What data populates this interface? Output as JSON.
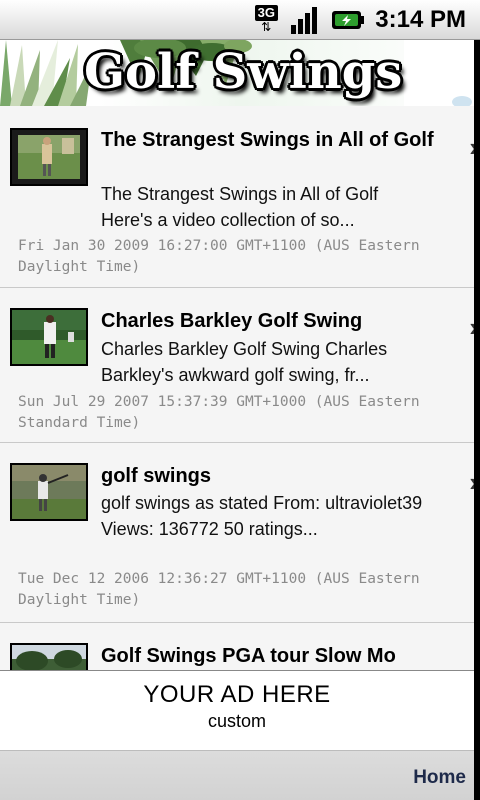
{
  "status_bar": {
    "network": "3G",
    "time": "3:14 PM"
  },
  "header": {
    "title": "Golf Swings"
  },
  "videos": [
    {
      "title": "The Strangest Swings in All of Golf",
      "description": "The Strangest Swings in All of Golf Here's a video collection of so...",
      "date": "Fri Jan 30 2009 16:27:00 GMT+1100 (AUS Eastern Daylight Time)"
    },
    {
      "title": "Charles Barkley Golf Swing",
      "description": "Charles Barkley Golf Swing Charles Barkley's awkward golf swing, fr...",
      "date": "Sun Jul 29 2007 15:37:39 GMT+1000 (AUS Eastern Standard Time)"
    },
    {
      "title": "golf swings",
      "description": "golf swings as stated From: ultraviolet39 Views: 136772 50 ratings...",
      "date": "Tue Dec 12 2006 12:36:27 GMT+1100 (AUS Eastern Daylight Time)"
    },
    {
      "title": "Golf Swings PGA tour Slow Mo"
    }
  ],
  "ad": {
    "title": "YOUR AD HERE",
    "subtitle": "custom"
  },
  "nav": {
    "home": "Home"
  },
  "icons": {
    "chevron": "›"
  },
  "colors": {
    "date_text": "#8a8a8a",
    "home_link": "#1e2a4a",
    "battery_green": "#2e9e2e"
  }
}
